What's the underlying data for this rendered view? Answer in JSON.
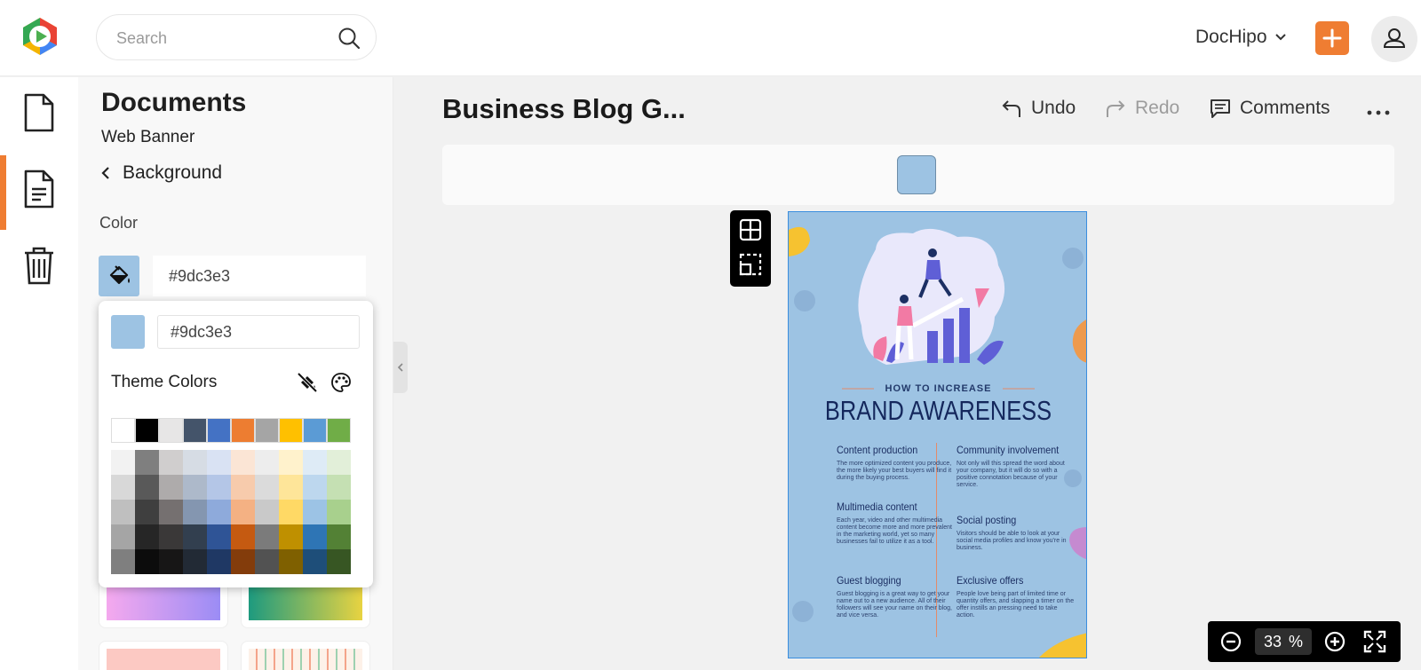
{
  "header": {
    "search_placeholder": "Search",
    "account_label": "DocHipo"
  },
  "rail": {
    "items": [
      "new-document",
      "documents",
      "trash"
    ],
    "active": "documents"
  },
  "panel": {
    "title": "Documents",
    "subtitle": "Web Banner",
    "back_label": "Background",
    "color_label": "Color",
    "color_value": "#9dc3e3"
  },
  "picker": {
    "hex_value": "#9dc3e3",
    "theme_label": "Theme Colors",
    "theme_row": [
      "#ffffff",
      "#000000",
      "#e7e6e6",
      "#44546a",
      "#4472c4",
      "#ed7d31",
      "#a5a5a5",
      "#ffc000",
      "#5b9bd5",
      "#70ad47"
    ],
    "shades": [
      [
        "#f2f2f2",
        "#7f7f7f",
        "#d0cece",
        "#d6dce4",
        "#d9e2f3",
        "#fbe5d5",
        "#ededed",
        "#fff2cc",
        "#deebf6",
        "#e2efd9"
      ],
      [
        "#d8d8d8",
        "#595959",
        "#aeabab",
        "#adb9ca",
        "#b4c6e7",
        "#f7cbac",
        "#dbdbdb",
        "#fee599",
        "#bdd7ee",
        "#c5e0b3"
      ],
      [
        "#bfbfbf",
        "#3f3f3f",
        "#757070",
        "#8496b0",
        "#8eaadb",
        "#f4b183",
        "#c9c9c9",
        "#ffd965",
        "#9cc3e5",
        "#a8d08d"
      ],
      [
        "#a5a5a5",
        "#262626",
        "#3a3838",
        "#323f4f",
        "#2f5496",
        "#c55a11",
        "#7b7b7b",
        "#bf9000",
        "#2e75b5",
        "#538135"
      ],
      [
        "#7f7f7f",
        "#0c0c0c",
        "#171616",
        "#222a35",
        "#1f3864",
        "#833c0b",
        "#525252",
        "#7f6000",
        "#1e4e79",
        "#375623"
      ]
    ]
  },
  "editor": {
    "doc_title": "Business Blog G...",
    "undo_label": "Undo",
    "redo_label": "Redo",
    "comments_label": "Comments",
    "active_bg_color": "#9dc3e3"
  },
  "design": {
    "kicker": "HOW TO INCREASE",
    "headline": "BRAND AWARENESS",
    "sections": [
      {
        "heading": "Content production",
        "body": "The more optimized content you produce, the more likely your best buyers will find it during the buying process."
      },
      {
        "heading": "Community involvement",
        "body": "Not only will this spread the word about your company, but it will do so with a positive connotation because of your service."
      },
      {
        "heading": "Multimedia content",
        "body": "Each year, video and other multimedia content become more and more prevalent in the marketing world, yet so many businesses fail to utilize it as a tool."
      },
      {
        "heading": "Social posting",
        "body": "Visitors should be able to look at your social media profiles and know you're in business."
      },
      {
        "heading": "Guest blogging",
        "body": "Guest blogging is a great way to get your name out to a new audience. All of their followers will see your name on their blog, and vice versa."
      },
      {
        "heading": "Exclusive offers",
        "body": "People love being part of limited time or quantity offers, and slapping a timer on the offer instills an pressing need to take action."
      }
    ]
  },
  "zoom": {
    "value": "33",
    "unit": "%"
  }
}
